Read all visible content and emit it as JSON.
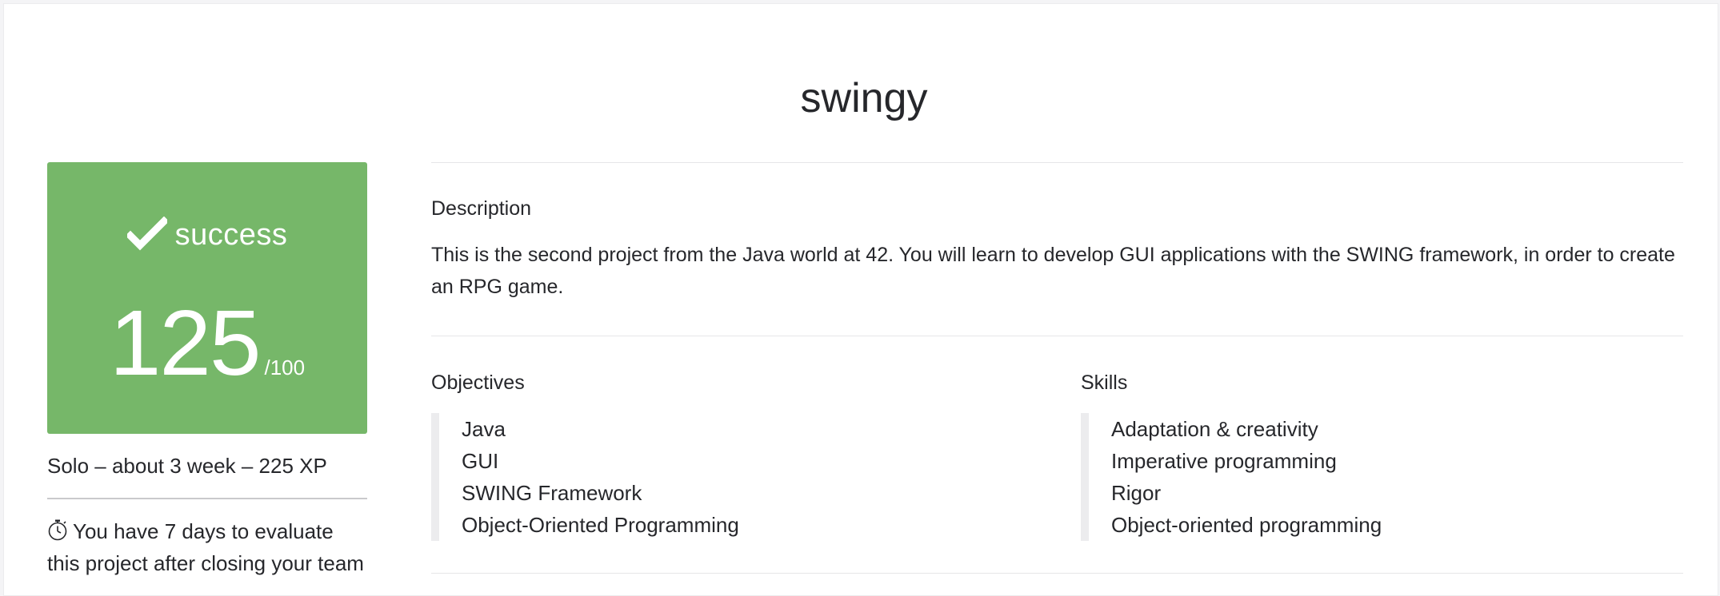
{
  "project": {
    "title": "swingy"
  },
  "result": {
    "status": "success",
    "score": "125",
    "score_max": "/100",
    "color": "#76b769"
  },
  "meta": {
    "summary": "Solo – about 3 week – 225 XP",
    "notice": "You have 7 days to evaluate this project after closing your team"
  },
  "description": {
    "label": "Description",
    "text": "This is the second project from the Java world at 42. You will learn to develop GUI applications with the SWING framework, in order to create an RPG game."
  },
  "objectives": {
    "label": "Objectives",
    "items": [
      "Java",
      "GUI",
      "SWING Framework",
      "Object-Oriented Programming"
    ]
  },
  "skills": {
    "label": "Skills",
    "items": [
      "Adaptation & creativity",
      "Imperative programming",
      "Rigor",
      "Object-oriented programming"
    ]
  }
}
